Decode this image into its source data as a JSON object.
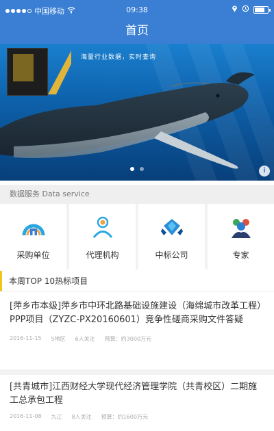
{
  "status_bar": {
    "carrier": "中国移动",
    "time": "09:38",
    "right_icons": [
      "location-icon",
      "alarm-icon",
      "battery-icon"
    ],
    "battery_level": 0.85
  },
  "nav": {
    "title": "首页"
  },
  "banner": {
    "caption": "海量行业数据，实时查询",
    "slide_count": 2,
    "active_slide": 1,
    "info_icon": "i"
  },
  "data_service": {
    "label": "数据服务 Data service"
  },
  "services": [
    {
      "label": "采购单位",
      "icon": "procurement-unit-icon"
    },
    {
      "label": "代理机构",
      "icon": "agency-icon"
    },
    {
      "label": "中标公司",
      "icon": "winning-company-icon"
    },
    {
      "label": "专家",
      "icon": "expert-icon"
    }
  ],
  "top10": {
    "label": "本周TOP 10热标项目"
  },
  "articles": [
    {
      "title": "[萍乡市本级]萍乡市中环北路基础设施建设（海绵城市改革工程）PPP项目（ZYZC-PX20160601）竞争性磋商采购文件答疑",
      "meta": [
        "2016-11-15",
        "5地区",
        "6人关注",
        "预算：约3000万元"
      ]
    },
    {
      "title": "[共青城市]江西财经大学现代经济管理学院（共青校区）二期施工总承包工程",
      "meta": [
        "2016-11-08",
        "九江",
        "8人关注",
        "预算：约1600万元"
      ]
    }
  ],
  "colors": {
    "brand_blue": "#3a7fd4",
    "accent_yellow": "#f0c419",
    "text_dark": "#333333",
    "text_muted": "#aaaaaa"
  }
}
